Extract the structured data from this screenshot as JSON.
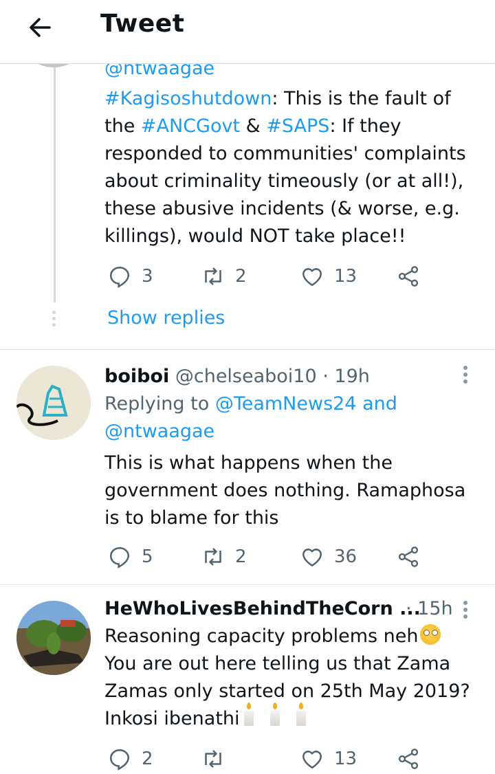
{
  "header": {
    "title": "Tweet"
  },
  "tweet1": {
    "handle_top": "@ntwaagae",
    "hashtag1": "#Kagisoshutdown",
    "text1": ": This is the fault of",
    "the": "the ",
    "hashtag2": "#ANCGovt",
    "amp": " & ",
    "hashtag3": "#SAPS",
    "text2": ": If they",
    "line3": "responded to communities' complaints",
    "line4": "about criminality timeously (or at all!),",
    "line5": "these abusive incidents (& worse, e.g.",
    "line6": "killings), would NOT take place!!",
    "replies": "3",
    "retweets": "2",
    "likes": "13",
    "show_replies": "Show replies"
  },
  "tweet2": {
    "name": "boiboi",
    "handle": "@chelseaboi10",
    "time": "· 19h",
    "replying_prefix": "Replying to ",
    "reply_to1": "@TeamNews24",
    "and": " and",
    "reply_to2": "@ntwaagae",
    "line1": "This is what happens when the",
    "line2": "government does  nothing. Ramaphosa",
    "line3": "is to blame for this",
    "replies": "5",
    "retweets": "2",
    "likes": "36"
  },
  "tweet3": {
    "name": "HeWhoLivesBehindTheCorn ...",
    "time": "· 15h",
    "line1": "Reasoning capacity problems neh",
    "line2": "You are out here telling us that Zama",
    "line3": "Zamas only started on  25th May 2019?",
    "line4": "Inkosi ibenathi",
    "replies": "2",
    "retweets": "",
    "likes": "13"
  },
  "icons": [
    "back-arrow-icon",
    "reply-icon",
    "retweet-icon",
    "like-icon",
    "share-icon",
    "more-icon"
  ],
  "colors": {
    "link": "#1d9bf0",
    "muted": "#536471",
    "divider": "#e1e6ea"
  }
}
